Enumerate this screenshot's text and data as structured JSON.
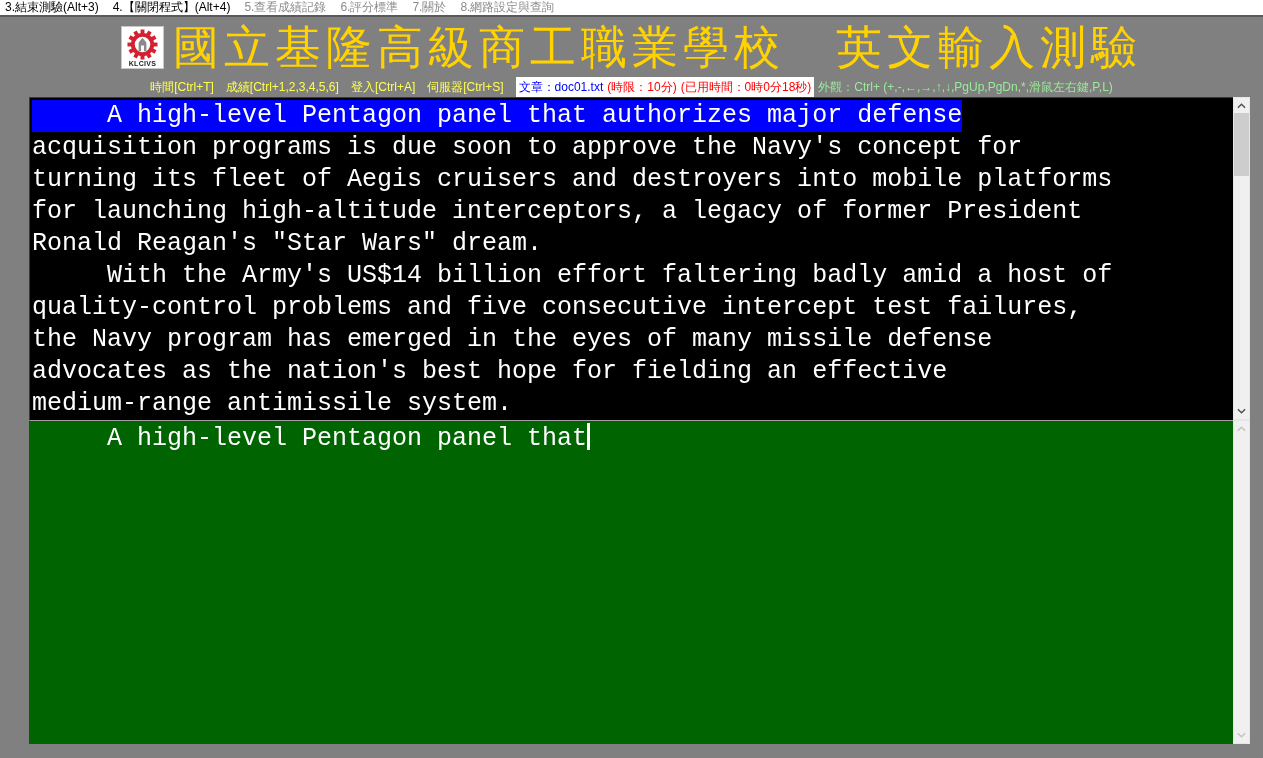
{
  "menu_bar": [
    {
      "label": "3.結束測驗(Alt+3)",
      "disabled": false
    },
    {
      "label": "4.【關閉程式】(Alt+4)",
      "disabled": false
    },
    {
      "label": "5.查看成績記錄",
      "disabled": true
    },
    {
      "label": "6.評分標準",
      "disabled": true
    },
    {
      "label": "7.關於",
      "disabled": true
    },
    {
      "label": "8.網路設定與查詢",
      "disabled": true
    }
  ],
  "header": {
    "logo_text": "KLCIVS",
    "title": "國立基隆高級商工職業學校　英文輸入測驗"
  },
  "status_bar": {
    "shortcuts": [
      "時間[Ctrl+T]",
      "成績[Ctrl+1,2,3,4,5,6]",
      "登入[Ctrl+A]",
      "伺服器[Ctrl+S]"
    ],
    "document": {
      "file": "文章：doc01.txt",
      "time_limit": "(時限：10分)",
      "elapsed": "(已用時間：0時0分18秒)"
    },
    "appearance_keys": "外觀：Ctrl+ (+,-,←,→,↑,↓,PgUp,PgDn,*,滑鼠左右鍵,P,L)"
  },
  "source_text": {
    "lines": [
      {
        "text": "     A high-level Pentagon panel that authorizes major defense",
        "highlighted": true
      },
      {
        "text": "acquisition programs is due soon to approve the Navy's concept for",
        "highlighted": false
      },
      {
        "text": "turning its fleet of Aegis cruisers and destroyers into mobile platforms",
        "highlighted": false
      },
      {
        "text": "for launching high-altitude interceptors, a legacy of former President",
        "highlighted": false
      },
      {
        "text": "Ronald Reagan's \"Star Wars\" dream.",
        "highlighted": false
      },
      {
        "text": "     With the Army's US$14 billion effort faltering badly amid a host of",
        "highlighted": false
      },
      {
        "text": "quality-control problems and five consecutive intercept test failures,",
        "highlighted": false
      },
      {
        "text": "the Navy program has emerged in the eyes of many missile defense",
        "highlighted": false
      },
      {
        "text": "advocates as the nation's best hope for fielding an effective",
        "highlighted": false
      },
      {
        "text": "medium-range antimissile system.",
        "highlighted": false
      }
    ]
  },
  "typing_area": {
    "value": "     A high-level Pentagon panel that"
  }
}
